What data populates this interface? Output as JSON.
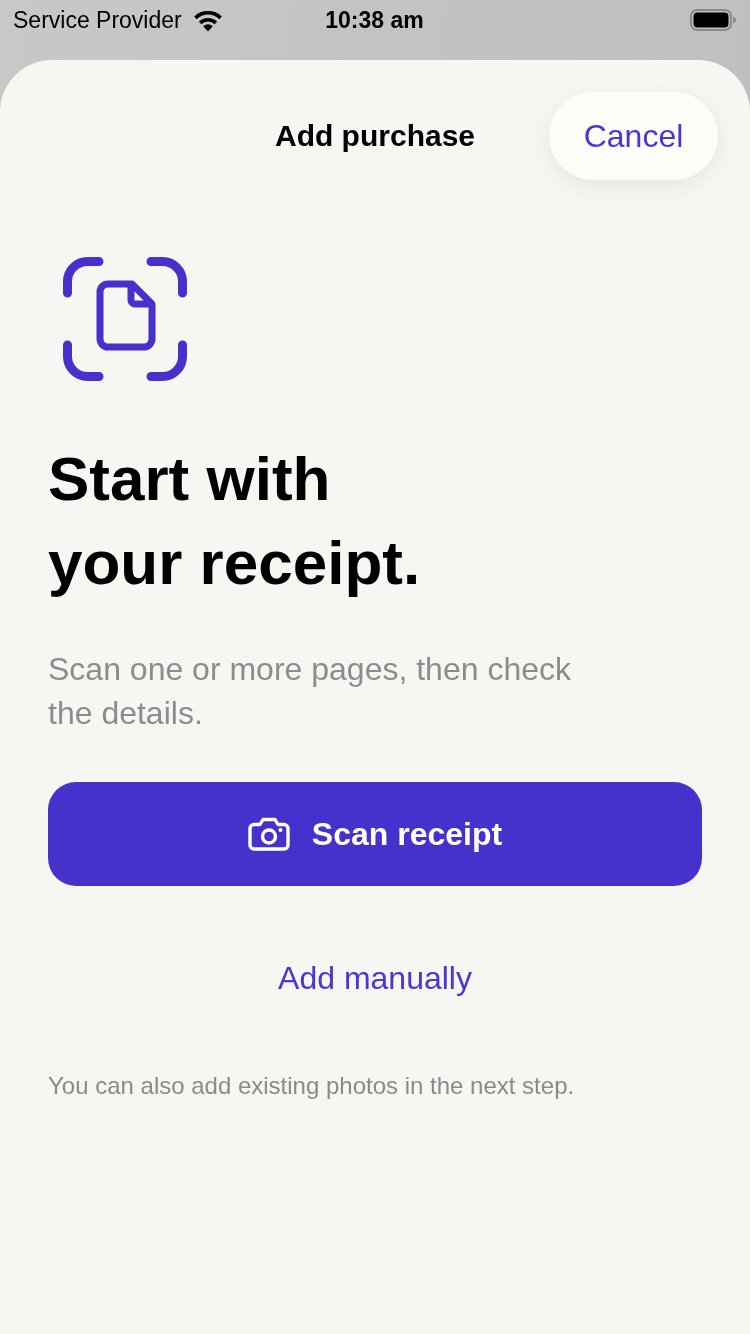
{
  "status_bar": {
    "carrier": "Service Provider",
    "time": "10:38 am"
  },
  "header": {
    "title": "Add purchase",
    "cancel_button": "Cancel"
  },
  "heading": "Start with\nyour receipt.",
  "description": "Scan one or more pages, then check the details.",
  "primary_button": {
    "label": "Scan receipt"
  },
  "secondary_link": "Add manually",
  "footnote": "You can also add existing photos in the next step."
}
